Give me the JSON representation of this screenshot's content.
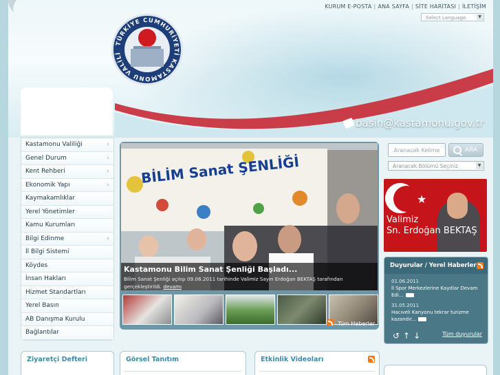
{
  "topnav": {
    "links": [
      "KURUM E-POSTA",
      "ANA SAYFA",
      "SİTE HARİTASI",
      "İLETİŞİM"
    ],
    "language_select": "Select Language"
  },
  "header": {
    "seal_text": "TÜRKİYE CUMHURİYETİ KASTAMONU VALİLİĞİ",
    "email": "basin@kastamonu.gov.tr"
  },
  "sidebar": {
    "items": [
      {
        "label": "Kastamonu Valiliği",
        "arrow": true
      },
      {
        "label": "Genel Durum",
        "arrow": true
      },
      {
        "label": "Kent Rehberi",
        "arrow": true
      },
      {
        "label": "Ekonomik Yapı",
        "arrow": true
      },
      {
        "label": "Kaymakamlıklar",
        "arrow": false
      },
      {
        "label": "Yerel Yönetimler",
        "arrow": false
      },
      {
        "label": "Kamu Kurumları",
        "arrow": false
      },
      {
        "label": "Bilgi Edinme",
        "arrow": true
      },
      {
        "label": "İl Bilgi Sistemi",
        "arrow": false
      },
      {
        "label": "Köydes",
        "arrow": false
      },
      {
        "label": "İnsan Hakları",
        "arrow": false
      },
      {
        "label": "Hizmet Standartları",
        "arrow": false
      },
      {
        "label": "Yerel Basın",
        "arrow": false
      },
      {
        "label": "AB Danışma Kurulu",
        "arrow": false
      },
      {
        "label": "Bağlantılar",
        "arrow": false
      }
    ]
  },
  "slider": {
    "banner_text": "BİLİM Sanat ŞENLİĞİ",
    "headline": "Kastamonu Bilim Sanat Şenliği Başladı...",
    "summary": "Bilim Sanat Şenliği açılışı 09.06.2011 tarihinde Valimiz Sayın Erdoğan BEKTAŞ tarafından gerçekleştirildi.",
    "more": "devamı",
    "all_news": "Tüm Haberler"
  },
  "search": {
    "placeholder": "Aranacak Kelime",
    "button": "ARA",
    "section_select": "Aranacak Bölümü Seçiniz"
  },
  "governor": {
    "line1": "Valimiz",
    "line2": "Sn. Erdoğan BEKTAŞ"
  },
  "announcements": {
    "title": "Duyurular / Yerel Haberler",
    "items": [
      {
        "date": "01.06.2011",
        "text": "İl Spor Merkezlerine Kayıtlar Devam Edi..."
      },
      {
        "date": "31.05.2011",
        "text": "Hacıveli Kanyonu tekrar turizme kazandır..."
      }
    ],
    "all_link": "Tüm duyurular",
    "controls": "↺↑↓"
  },
  "bottom": {
    "guestbook": "Ziyaretçi Defteri",
    "visual_promo": "Görsel Tanıtım",
    "event_videos": "Etkinlik Videoları"
  },
  "colors": {
    "accent": "#3f8aa6",
    "sidebar_text": "#1e3a48",
    "slider_frame": "#6d97a6",
    "flag_red": "#c5141a"
  }
}
